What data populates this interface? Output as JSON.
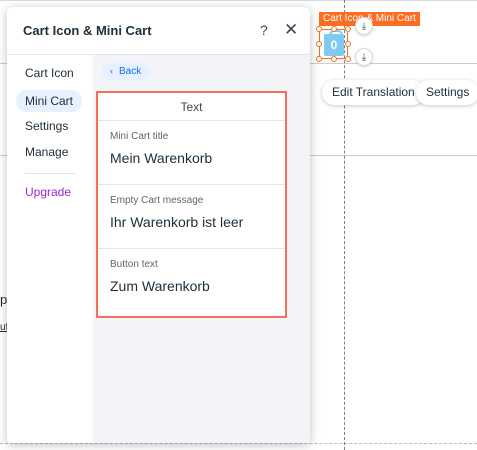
{
  "panel": {
    "title": "Cart Icon & Mini Cart",
    "help_icon": "?",
    "close_icon": "✕",
    "nav": [
      {
        "label": "Cart Icon"
      },
      {
        "label": "Mini Cart",
        "active": true
      },
      {
        "label": "Settings"
      },
      {
        "label": "Manage"
      }
    ],
    "upgrade_label": "Upgrade",
    "back_label": "Back",
    "section_title": "Text",
    "fields": [
      {
        "label": "Mini Cart title",
        "value": "Mein Warenkorb"
      },
      {
        "label": "Empty Cart message",
        "value": "Ihr Warenkorb ist leer"
      },
      {
        "label": "Button text",
        "value": "Zum Warenkorb"
      }
    ]
  },
  "canvas": {
    "element_tag": "Cart Icon & Mini Cart",
    "cart_count": "0",
    "edit_translation_label": "Edit Translation",
    "settings_label": "Settings",
    "left_fragment_1": "p",
    "left_fragment_2": "uf",
    "download_icon": "⤓"
  },
  "colors": {
    "accent_blue": "#116dff",
    "selection_orange": "#fb6d21",
    "highlight_red": "#f0715a",
    "upgrade_purple": "#9a27d5",
    "nav_active_bg": "#e7f0ff"
  }
}
